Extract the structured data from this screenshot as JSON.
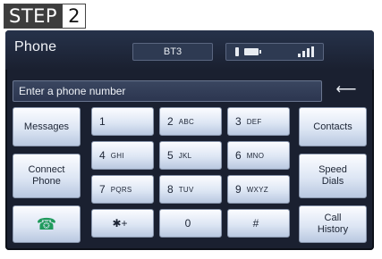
{
  "step": {
    "word": "STEP",
    "number": "2"
  },
  "header": {
    "title": "Phone",
    "device": "BT3"
  },
  "status": {
    "icons": [
      "bluetooth-icon",
      "battery-icon",
      "signal-icon"
    ]
  },
  "number_input": {
    "placeholder": "Enter a phone number",
    "value": ""
  },
  "backspace_icon": "backspace-icon",
  "left_buttons": {
    "messages": "Messages",
    "connect_phone_line1": "Connect",
    "connect_phone_line2": "Phone",
    "call_icon": "phone-handset-icon"
  },
  "keypad": [
    {
      "digit": "1",
      "letters": ""
    },
    {
      "digit": "2",
      "letters": "ABC"
    },
    {
      "digit": "3",
      "letters": "DEF"
    },
    {
      "digit": "4",
      "letters": "GHI"
    },
    {
      "digit": "5",
      "letters": "JKL"
    },
    {
      "digit": "6",
      "letters": "MNO"
    },
    {
      "digit": "7",
      "letters": "PQRS"
    },
    {
      "digit": "8",
      "letters": "TUV"
    },
    {
      "digit": "9",
      "letters": "WXYZ"
    },
    {
      "digit": "✱+",
      "letters": ""
    },
    {
      "digit": "0",
      "letters": ""
    },
    {
      "digit": "#",
      "letters": ""
    }
  ],
  "right_buttons": {
    "contacts": "Contacts",
    "speed_dials_line1": "Speed",
    "speed_dials_line2": "Dials",
    "call_history_line1": "Call",
    "call_history_line2": "History"
  },
  "colors": {
    "screen_bg": "#1a2030",
    "button_top": "#fbfcff",
    "button_bottom": "#b9c8e0",
    "call_green": "#1f9a5c"
  }
}
